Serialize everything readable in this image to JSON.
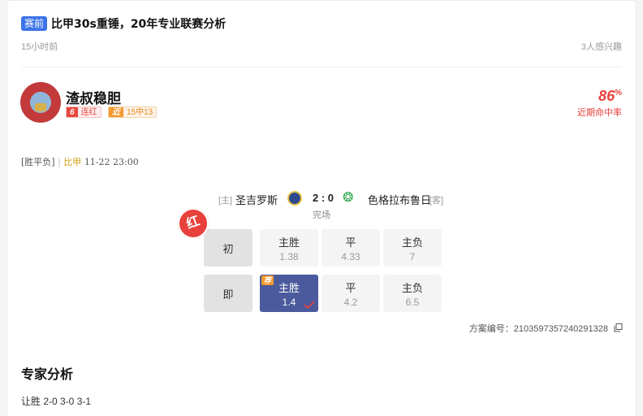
{
  "header": {
    "tag": "赛前",
    "title": "比甲30s重锤，20年专业联赛分析",
    "time": "15小时前",
    "interest": "3人感兴趣"
  },
  "author": {
    "name": "渣叔稳胆",
    "streak_num": "6",
    "streak_label": "连红",
    "recent_num": "近",
    "recent_label": "15中13",
    "hit_rate_value": "86",
    "hit_rate_unit": "%",
    "hit_rate_label": "近期命中率"
  },
  "play": {
    "type": "[胜平负]",
    "separator": "|",
    "league": "比甲",
    "datetime": "11-22 23:00"
  },
  "match": {
    "home_tag": "[主]",
    "home": "圣吉罗斯",
    "score": "2 : 0",
    "away": "色格拉布鲁日",
    "away_tag": "[客]",
    "status": "完场",
    "result_seal": "红"
  },
  "odds": {
    "initial": {
      "label": "初",
      "options": [
        {
          "name": "主胜",
          "value": "1.38"
        },
        {
          "name": "平",
          "value": "4.33"
        },
        {
          "name": "主负",
          "value": "7"
        }
      ]
    },
    "current": {
      "label": "即",
      "recommend_tag": "荐",
      "options": [
        {
          "name": "主胜",
          "value": "1.4"
        },
        {
          "name": "平",
          "value": "4.2"
        },
        {
          "name": "主负",
          "value": "6.5"
        }
      ]
    }
  },
  "plan": {
    "id_text": "方案编号：2103597357240291328"
  },
  "analysis": {
    "title": "专家分析",
    "body": "让胜 2-0 3-0 3-1"
  },
  "colors": {
    "accent_blue": "#3b73e8",
    "red": "#e8403a",
    "selected": "#4a5a9c",
    "orange": "#f39a2e"
  }
}
